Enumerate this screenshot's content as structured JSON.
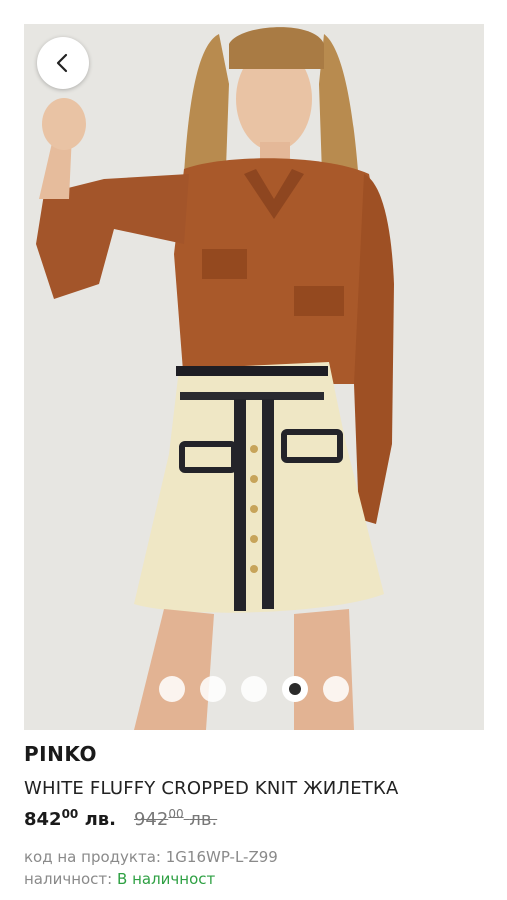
{
  "product": {
    "brand": "PINKO",
    "title": "WHITE FLUFFY CROPPED KNIT ЖИЛЕТКА",
    "price": {
      "main": "842",
      "cents": "00",
      "currency": "лв."
    },
    "old_price": {
      "main": "942",
      "cents": "00",
      "currency": "лв."
    },
    "code_label": "код на продукта:",
    "code_value": "1G16WP-L-Z99",
    "availability_label": "наличност:",
    "availability_value": "В наличност"
  },
  "gallery": {
    "image_count": 5,
    "active_index": 3
  },
  "colors": {
    "availability": "#2ea043"
  }
}
